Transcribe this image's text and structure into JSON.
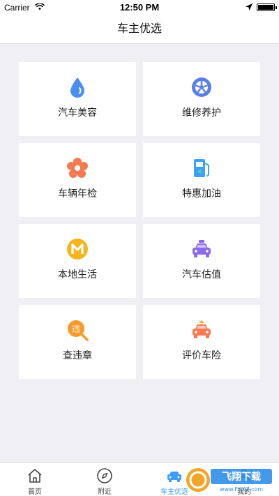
{
  "status_bar": {
    "carrier": "Carrier",
    "time": "12:50 PM",
    "battery_level": 1.0
  },
  "header": {
    "title": "车主优选"
  },
  "services": [
    {
      "label": "汽车美容",
      "icon": "water-drop-icon",
      "color": "#4a8ef0"
    },
    {
      "label": "维修养护",
      "icon": "wheel-icon",
      "color": "#5b7fe8"
    },
    {
      "label": "车辆年检",
      "icon": "flower-badge-icon",
      "color": "#f57a52"
    },
    {
      "label": "特惠加油",
      "icon": "fuel-pump-icon",
      "color": "#3fa0f5"
    },
    {
      "label": "本地生活",
      "icon": "m-badge-icon",
      "color": "#f5b51f"
    },
    {
      "label": "汽车估值",
      "icon": "car-icon",
      "color": "#8b6be8"
    },
    {
      "label": "查违章",
      "icon": "violation-search-icon",
      "color": "#f79a2b",
      "icon_text": "违"
    },
    {
      "label": "评价车险",
      "icon": "insurance-car-icon",
      "color": "#f57a52"
    }
  ],
  "tabs": [
    {
      "label": "首页",
      "icon": "home-icon",
      "active": false
    },
    {
      "label": "附近",
      "icon": "compass-icon",
      "active": false
    },
    {
      "label": "车主优选",
      "icon": "car-icon",
      "active": true
    },
    {
      "label": "我的",
      "icon": "user-icon",
      "active": false
    }
  ],
  "watermark": {
    "text": "飞翔下载",
    "url": "www.FXXZ.com"
  },
  "colors": {
    "accent": "#3d9df7",
    "background": "#efeff4"
  }
}
